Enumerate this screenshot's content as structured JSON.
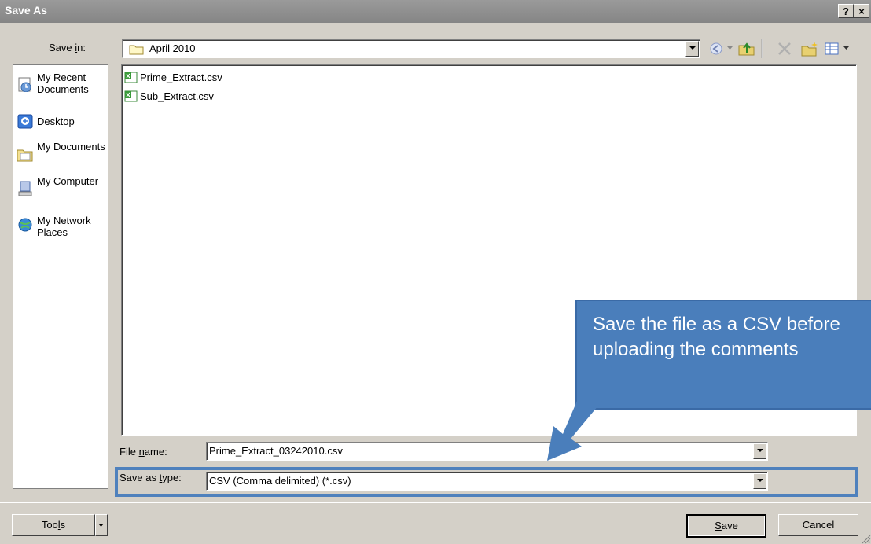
{
  "window": {
    "title": "Save As",
    "help_label": "?",
    "close_label": "×"
  },
  "save_in": {
    "label_pre": "Save ",
    "label_key": "i",
    "label_post": "n:",
    "value": "April 2010"
  },
  "toolbar": {
    "icons": [
      "back-icon",
      "dropdown-arrow-icon",
      "up-folder-icon",
      "delete-icon",
      "new-folder-icon",
      "views-icon",
      "views-dropdown-icon"
    ]
  },
  "places": [
    {
      "label": "My Recent Documents",
      "icon": "recent-documents-icon"
    },
    {
      "label": "Desktop",
      "icon": "desktop-icon"
    },
    {
      "label": "My Documents",
      "icon": "my-documents-icon"
    },
    {
      "label": "My Computer",
      "icon": "my-computer-icon"
    },
    {
      "label": "My Network Places",
      "icon": "network-places-icon"
    }
  ],
  "files": [
    {
      "name": "Prime_Extract.csv",
      "icon": "csv-file-icon"
    },
    {
      "name": "Sub_Extract.csv",
      "icon": "csv-file-icon"
    }
  ],
  "file_name": {
    "label_pre": "File ",
    "label_key": "n",
    "label_post": "ame:",
    "value": "Prime_Extract_03242010.csv"
  },
  "save_type": {
    "label_pre": "Save as ",
    "label_key": "t",
    "label_post": "ype:",
    "value": "CSV (Comma delimited) (*.csv)"
  },
  "buttons": {
    "tools_pre": "Too",
    "tools_key": "l",
    "tools_post": "s",
    "save_key": "S",
    "save_post": "ave",
    "cancel": "Cancel"
  },
  "callout": {
    "text": "Save the file as a CSV before uploading the comments"
  },
  "colors": {
    "callout": "#4a7ebb",
    "highlight": "#4f81bd",
    "titlebar": "#8f8f8f"
  }
}
